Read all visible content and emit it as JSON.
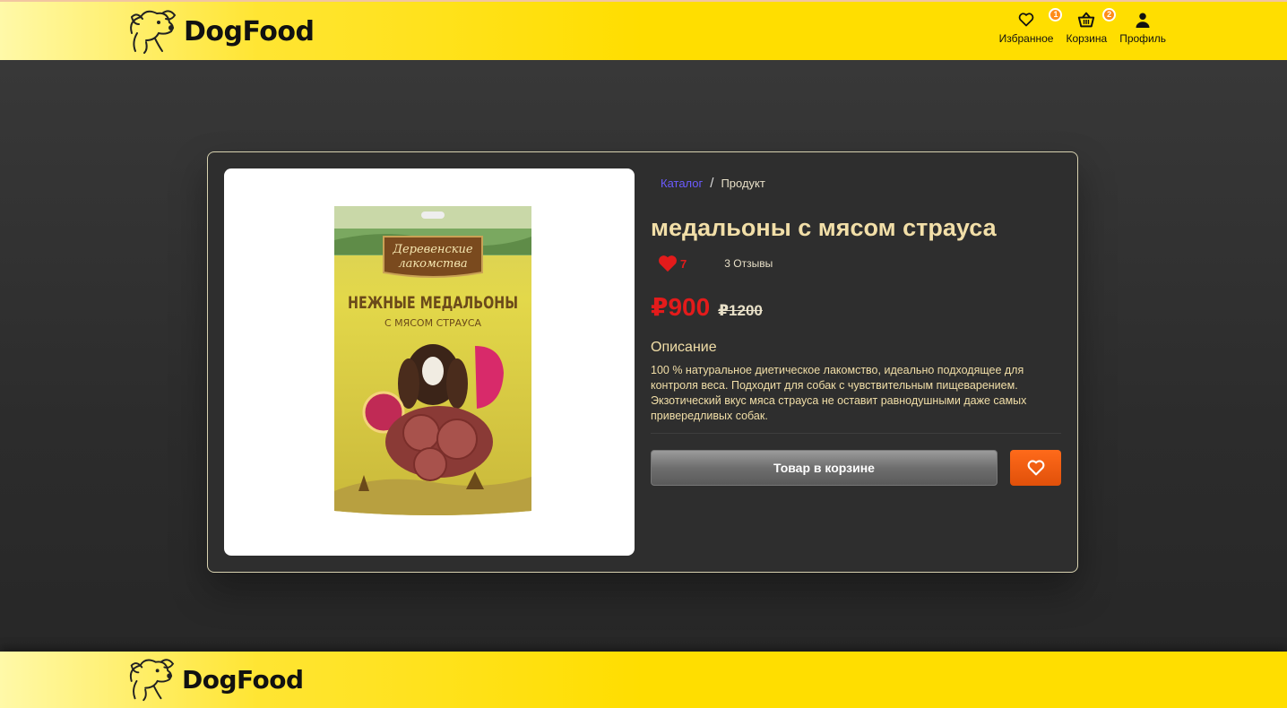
{
  "header": {
    "logo_text": "DogFood",
    "nav": {
      "favorites": {
        "label": "Избранное",
        "count": "1"
      },
      "cart": {
        "label": "Корзина",
        "count": "2"
      },
      "profile": {
        "label": "Профиль"
      }
    }
  },
  "breadcrumb": {
    "catalog": "Каталог",
    "separator": "/",
    "current": "Продукт"
  },
  "product": {
    "title": "медальоны с мясом страуса",
    "likes": "7",
    "reviews": "3 Отзывы",
    "price": "₽900",
    "old_price": "₽1200",
    "description_title": "Описание",
    "description": "100 % натуральное диетическое лакомство, идеально подходящее для контроля веса. Подходит для собак с чувствительным пищеварением. Экзотический вкус мяса страуса не оставит равнодушными даже самых привередливых собак.",
    "package": {
      "brand_line1": "Деревенские",
      "brand_line2": "лакомства",
      "name_line1": "НЕЖНЫЕ МЕДАЛЬОНЫ",
      "name_line2": "С МЯСОМ СТРАУСА"
    }
  },
  "actions": {
    "cart_button": "Товар в корзине"
  },
  "footer": {
    "logo_text": "DogFood"
  },
  "colors": {
    "accent_yellow": "#ffde00",
    "price_red": "#e31b1b",
    "fav_orange": "#ff6a1a",
    "title_cream": "#f2dfa8"
  }
}
